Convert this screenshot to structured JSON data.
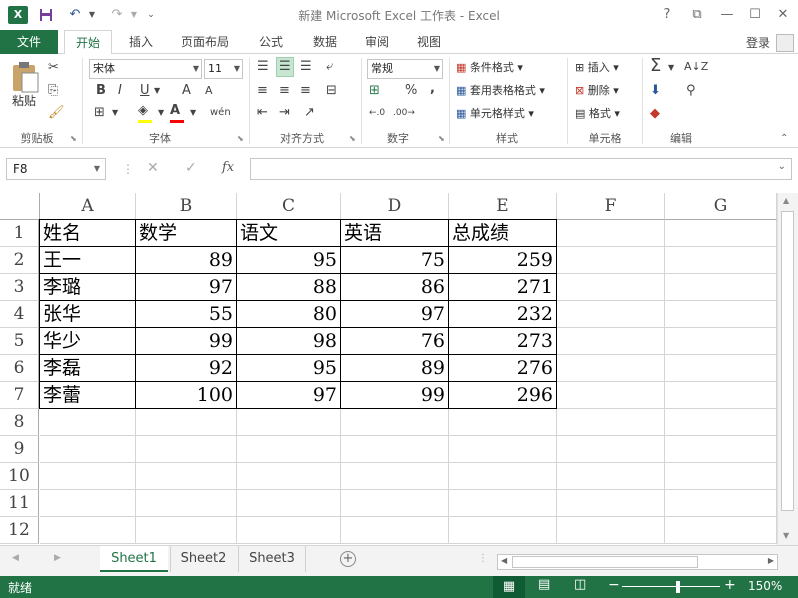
{
  "title": "新建 Microsoft Excel 工作表 - Excel",
  "app_icon": "X",
  "window": {
    "help": "?",
    "restore_ribbon": "⧉",
    "minimize": "—",
    "maximize": "☐",
    "close": "✕"
  },
  "quick_access": {
    "save": "save-icon",
    "undo": "↶",
    "redo": "↷"
  },
  "tabs": {
    "file": "文件",
    "items": [
      "开始",
      "插入",
      "页面布局",
      "公式",
      "数据",
      "审阅",
      "视图"
    ],
    "active": "开始"
  },
  "login": "登录",
  "ribbon": {
    "clipboard": {
      "paste": "粘贴",
      "label": "剪贴板"
    },
    "font": {
      "name": "宋体",
      "size": "11",
      "bold": "B",
      "italic": "I",
      "underline": "U",
      "grow": "A",
      "shrink": "A",
      "wen": "wén",
      "label": "字体",
      "fill_color": "#ffff00",
      "font_color": "#ff0000"
    },
    "alignment": {
      "label": "对齐方式"
    },
    "number": {
      "format": "常规",
      "percent": "%",
      "comma": ",",
      "label": "数字"
    },
    "styles": {
      "conditional": "条件格式",
      "table": "套用表格格式",
      "cell_styles": "单元格样式",
      "label": "样式"
    },
    "cells": {
      "insert": "插入",
      "delete": "删除",
      "format": "格式",
      "label": "单元格"
    },
    "editing": {
      "label": "编辑"
    }
  },
  "formula_bar": {
    "name_box": "F8",
    "cancel": "✕",
    "enter": "✓",
    "fx": "fx",
    "value": ""
  },
  "columns": [
    "A",
    "B",
    "C",
    "D",
    "E",
    "F",
    "G"
  ],
  "rows": [
    "1",
    "2",
    "3",
    "4",
    "5",
    "6",
    "7",
    "8",
    "9",
    "10",
    "11",
    "12"
  ],
  "table": {
    "header": [
      "姓名",
      "数学",
      "语文",
      "英语",
      "总成绩"
    ],
    "rows": [
      [
        "王一",
        "89",
        "95",
        "75",
        "259"
      ],
      [
        "李璐",
        "97",
        "88",
        "86",
        "271"
      ],
      [
        "张华",
        "55",
        "80",
        "97",
        "232"
      ],
      [
        "华少",
        "99",
        "98",
        "76",
        "273"
      ],
      [
        "李磊",
        "92",
        "95",
        "89",
        "276"
      ],
      [
        "李蕾",
        "100",
        "97",
        "99",
        "296"
      ]
    ]
  },
  "sheets": [
    "Sheet1",
    "Sheet2",
    "Sheet3"
  ],
  "active_sheet": "Sheet1",
  "add_sheet": "+",
  "status": {
    "ready": "就绪",
    "zoom": "150%",
    "zoom_minus": "−",
    "zoom_plus": "+"
  },
  "colors": {
    "accent": "#217346"
  }
}
